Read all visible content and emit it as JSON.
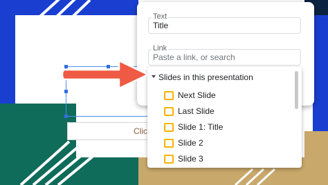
{
  "canvas": {
    "click_hint": "Click"
  },
  "link_dialog": {
    "text_label": "Text",
    "text_value": "Title",
    "link_label": "Link",
    "link_placeholder": "Paste a link, or search"
  },
  "dropdown": {
    "section_label": "Slides in this presentation",
    "items": [
      {
        "label": "Next Slide"
      },
      {
        "label": "Last Slide"
      },
      {
        "label": "Slide 1: Title"
      },
      {
        "label": "Slide 2"
      },
      {
        "label": "Slide 3"
      }
    ]
  },
  "colors": {
    "arrow": "#ef5a44",
    "slide_icon": "#f4b400",
    "selection": "#4a8ef0",
    "bg_blue": "#1a3fd0",
    "bg_green": "#0f6b5a",
    "bg_gold": "#c9a86b",
    "bg_navy": "#0b2340"
  }
}
